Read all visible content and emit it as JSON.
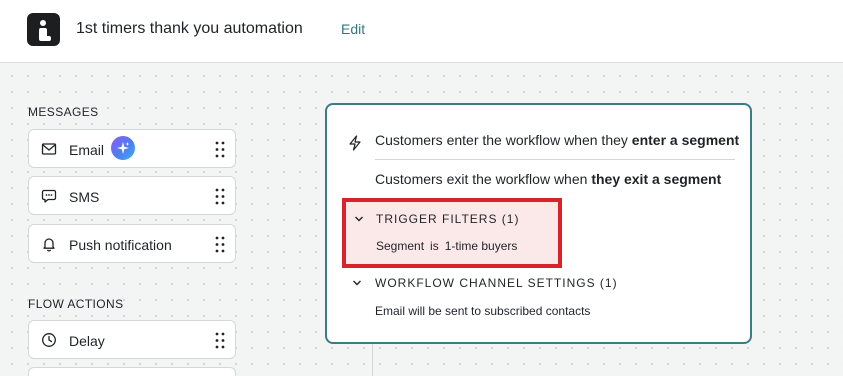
{
  "header": {
    "title": "1st timers thank you automation",
    "edit_label": "Edit",
    "logo_icon": "brand-logo-icon"
  },
  "sidebar": {
    "messages_label": "MESSAGES",
    "messages": [
      {
        "label": "Email",
        "icon": "envelope-icon",
        "badge_icon": "ai-sparkle-icon"
      },
      {
        "label": "SMS",
        "icon": "chat-bubble-icon"
      },
      {
        "label": "Push notification",
        "icon": "bell-icon"
      }
    ],
    "flow_actions_label": "FLOW ACTIONS",
    "flow_actions": [
      {
        "label": "Delay",
        "icon": "clock-icon"
      }
    ]
  },
  "trigger_card": {
    "enter_prefix": "Customers enter the workflow when they ",
    "enter_bold": "enter a segment",
    "exit_prefix": "Customers exit the workflow when ",
    "exit_bold": "they exit a segment",
    "filters_heading": "TRIGGER FILTERS (1)",
    "filter": {
      "field": "Segment",
      "operator": "is",
      "value": "1-time buyers"
    },
    "channel_heading": "WORKFLOW CHANNEL SETTINGS (1)",
    "channel_detail": "Email will be sent to subscribed contacts"
  },
  "colors": {
    "accent": "#2f7a82",
    "card_border": "#3a7d84",
    "highlight_border": "#d8232a",
    "highlight_fill": "#fbe9ea"
  }
}
